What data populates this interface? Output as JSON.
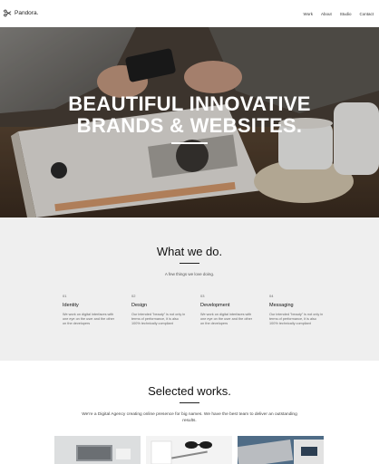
{
  "header": {
    "logo_text": "Pandora.",
    "nav": [
      "Work",
      "About",
      "Studio",
      "Contact"
    ]
  },
  "hero": {
    "title_line1": "BEAUTIFUL INNOVATIVE",
    "title_line2": "BRANDS & WEBSITES."
  },
  "what_we_do": {
    "title": "What we do.",
    "subtitle": "A few things we love doing.",
    "services": [
      {
        "num": "01",
        "name": "Identity",
        "desc": "We work on digital interfaces with one eye on the user and the other on the developers"
      },
      {
        "num": "02",
        "name": "Design",
        "desc": "Our intended \"beauty\" is not only in terms of performance, it is also 100% technically compliant"
      },
      {
        "num": "03",
        "name": "Development",
        "desc": "We work on digital interfaces with one eye on the user and the other on the developers"
      },
      {
        "num": "04",
        "name": "Messaging",
        "desc": "Our intended \"beauty\" is not only in terms of performance, it is also 100% technically compliant"
      }
    ]
  },
  "works": {
    "title": "Selected works.",
    "text": "We're a Digital Agency creating online presence for big names. We have the best team to deliver an outstanding results."
  },
  "colors": {
    "section_bg": "#efefef",
    "text_dark": "#111111",
    "hero_text": "#ffffff"
  }
}
